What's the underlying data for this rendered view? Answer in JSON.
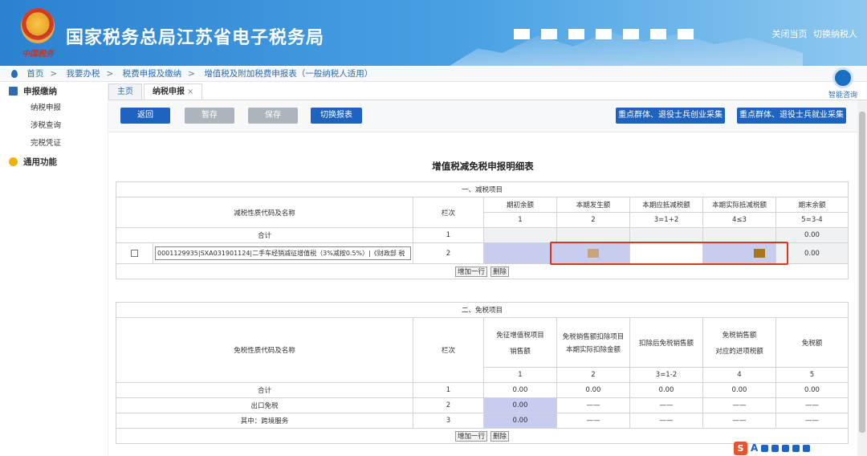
{
  "header": {
    "emblem_text": "中国税务",
    "site_title": "国家税务总局江苏省电子税务局",
    "close_page": "关闭当页",
    "switch_taxpayer": "切换纳税人"
  },
  "breadcrumb": [
    "首页",
    "我要办税",
    "税费申报及缴纳",
    "增值税及附加税费申报表（一般纳税人适用）"
  ],
  "assistant": {
    "label": "智能咨询"
  },
  "sidebar": {
    "groups": [
      {
        "label": "申报缴纳",
        "items": [
          "纳税申报",
          "涉税查询",
          "完税凭证"
        ]
      },
      {
        "label": "通用功能",
        "items": []
      }
    ]
  },
  "tabs": [
    {
      "label": "主页",
      "active": false
    },
    {
      "label": "纳税申报",
      "active": true,
      "close": "×"
    }
  ],
  "toolbar": {
    "back": "返回",
    "temp_save": "暂存",
    "save": "保存",
    "switch_form": "切换报表",
    "collect_entrepreneur": "重点群体、退役士兵创业采集",
    "collect_employment": "重点群体、退役士兵就业采集"
  },
  "form_title": "增值税减免税申报明细表",
  "reduction": {
    "section_title": "一、减税项目",
    "col_name": "减税性质代码及名称",
    "col_line": "栏次",
    "headers": [
      "期初余额",
      "本期发生额",
      "本期应抵减税额",
      "本期实际抵减税额",
      "期末余额"
    ],
    "formulas": [
      "1",
      "2",
      "3=1+2",
      "4≤3",
      "5=3-4"
    ],
    "rows": [
      {
        "name": "合计",
        "line": "1",
        "values": [
          "",
          "",
          "",
          "",
          "0.00"
        ]
      },
      {
        "name": "0001129935|SXA031901124|二手车经销减征增值税（3%减按0.5%）|《财政部 税",
        "line": "2",
        "values": [
          "",
          "",
          "",
          "",
          "0.00"
        ]
      }
    ],
    "add_row": "增加一行",
    "delete": "删除"
  },
  "exemption": {
    "section_title": "二、免税项目",
    "col_name": "免税性质代码及名称",
    "col_line": "栏次",
    "headers": [
      [
        "免征增值税项目",
        "销售额"
      ],
      [
        "免税销售额扣除项目",
        "本期实际扣除金额"
      ],
      [
        "扣除后免税销售额"
      ],
      [
        "免税销售额",
        "对应的进项税额"
      ],
      [
        "免税额"
      ]
    ],
    "formulas": [
      "1",
      "2",
      "3=1-2",
      "4",
      "5"
    ],
    "rows": [
      {
        "name": "合计",
        "line": "1",
        "values": [
          "0.00",
          "0.00",
          "0.00",
          "0.00",
          "0.00"
        ]
      },
      {
        "name": "出口免税",
        "line": "2",
        "values": [
          "0.00",
          "——",
          "——",
          "——",
          "——"
        ]
      },
      {
        "name": "其中：跨境服务",
        "line": "3",
        "values": [
          "0.00",
          "——",
          "——",
          "——",
          "——"
        ]
      }
    ],
    "add_row": "增加一行",
    "delete": "删除"
  },
  "colors": {
    "header_blue": "#2a82d1",
    "button_blue": "#1f63c1",
    "highlight_red": "#e03323",
    "input_blue": "#c6cdef"
  }
}
